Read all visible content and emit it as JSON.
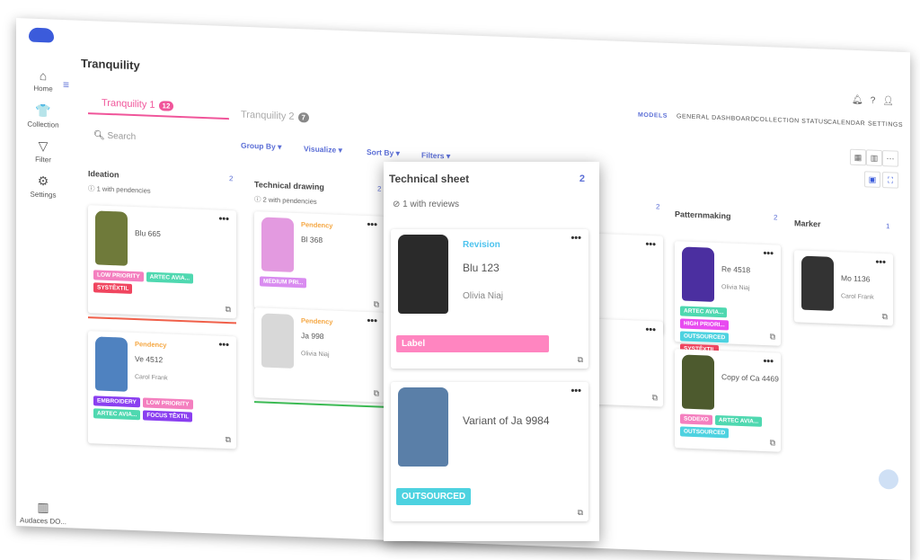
{
  "brand_color": "#3b5bdb",
  "accent_color": "#f0559a",
  "sidebar": {
    "items": [
      {
        "label": "Home",
        "icon": "home-icon",
        "glyph": "⌂"
      },
      {
        "label": "Collection",
        "icon": "shirt-icon",
        "glyph": "👕"
      },
      {
        "label": "Filter",
        "icon": "filter-icon",
        "glyph": "▽"
      },
      {
        "label": "Settings",
        "icon": "gear-icon",
        "glyph": "⚙"
      }
    ],
    "footer": "Audaces DO..."
  },
  "header": {
    "title": "Tranquility",
    "nav": [
      "MODELS",
      "GENERAL DASHBOARD",
      "COLLECTION STATUS",
      "CALENDAR",
      "SETTINGS"
    ],
    "active_nav": "MODELS"
  },
  "tabs": [
    {
      "label": "Tranquility 1",
      "count": "12",
      "active": true
    },
    {
      "label": "Tranquility 2",
      "count": "7",
      "active": false
    }
  ],
  "toolbar": {
    "search_placeholder": "Search",
    "group_by": "Group By",
    "visualize": "Visualize",
    "sort_by": "Sort By",
    "filters": "Filters"
  },
  "columns": [
    {
      "title": "Ideation",
      "count": "2",
      "sub": "1 with pendencies",
      "cards": [
        {
          "name": "Blu 665",
          "owner": "",
          "status": "",
          "tags": [
            [
              "LOW PRIORITY",
              "#f47fbf"
            ],
            [
              "ARTEC AVIA...",
              "#4fd8b0"
            ],
            [
              "SYSTÊXTIL",
              "#f0455f"
            ]
          ],
          "bar": "#f0604a",
          "img": "#6f7a3a"
        },
        {
          "name": "Ve 4512",
          "owner": "Carol Frank",
          "status": "Pendency",
          "tags": [
            [
              "EMBROIDERY",
              "#8a3ff0"
            ],
            [
              "LOW PRIORITY",
              "#f47fbf"
            ],
            [
              "ARTEC AVIA...",
              "#4fd8b0"
            ],
            [
              "FOCUS TÊXTIL",
              "#8a3ff0"
            ]
          ],
          "bar": "",
          "img": "#4f82c0"
        }
      ]
    },
    {
      "title": "Technical drawing",
      "count": "2",
      "sub": "2 with pendencies",
      "cards": [
        {
          "name": "Bl 368",
          "owner": "",
          "status": "Pendency",
          "tags": [
            [
              "MEDIUM PRI...",
              "#d98cf0"
            ]
          ],
          "bar": "#f0604a",
          "img": "#e39ae0"
        },
        {
          "name": "Ja 998",
          "owner": "Olivia Niaj",
          "status": "Pendency",
          "tags": [],
          "bar": "#3cba54",
          "img": "#d8d8d8"
        }
      ]
    },
    {
      "title": "",
      "count": "2",
      "sub": "",
      "cards": [
        {
          "name": "469",
          "owner": "Niaj",
          "status": "",
          "tags": [],
          "bar": "",
          "img": ""
        },
        {
          "name": "62",
          "owner": "",
          "status": "",
          "tags": [
            [
              "HIGH PRIORI...",
              "#e84bf0"
            ]
          ],
          "bar": "",
          "img": ""
        }
      ]
    },
    {
      "title": "Patternmaking",
      "count": "2",
      "sub": "",
      "cards": [
        {
          "name": "Re 4518",
          "owner": "Olivia Niaj",
          "status": "",
          "tags": [
            [
              "ARTEC AVIA...",
              "#4fd8b0"
            ],
            [
              "HIGH PRIORI...",
              "#e84bf0"
            ],
            [
              "OUTSOURCED",
              "#4dd2e0"
            ],
            [
              "SYSTÊXTIL",
              "#f0455f"
            ]
          ],
          "bar": "",
          "img": "#4b2fa0"
        },
        {
          "name": "Copy of Ca 4469",
          "owner": "",
          "status": "",
          "tags": [
            [
              "SODEXO",
              "#f47fbf"
            ],
            [
              "ARTEC AVIA...",
              "#4fd8b0"
            ],
            [
              "OUTSOURCED",
              "#4dd2e0"
            ]
          ],
          "bar": "",
          "img": "#4d5a2e"
        }
      ]
    },
    {
      "title": "Marker",
      "count": "1",
      "sub": "",
      "cards": [
        {
          "name": "Mo 1136",
          "owner": "Carol Frank",
          "status": "",
          "tags": [],
          "bar": "",
          "img": "#333"
        }
      ]
    }
  ],
  "overlay": {
    "title": "Technical sheet",
    "count": "2",
    "sub": "1 with reviews",
    "cards": [
      {
        "name": "Blu 123",
        "owner": "Olivia Niaj",
        "status": "Revision",
        "tags": [
          [
            "Label",
            "#ff85c0"
          ]
        ],
        "bar": "",
        "img": "#2a2a2a"
      },
      {
        "name": "Variant of Ja 9984",
        "owner": "",
        "status": "",
        "tags": [
          [
            "OUTSOURCED",
            "#4dd2e0"
          ]
        ],
        "bar": "",
        "img": "#5a7fa8"
      }
    ]
  }
}
